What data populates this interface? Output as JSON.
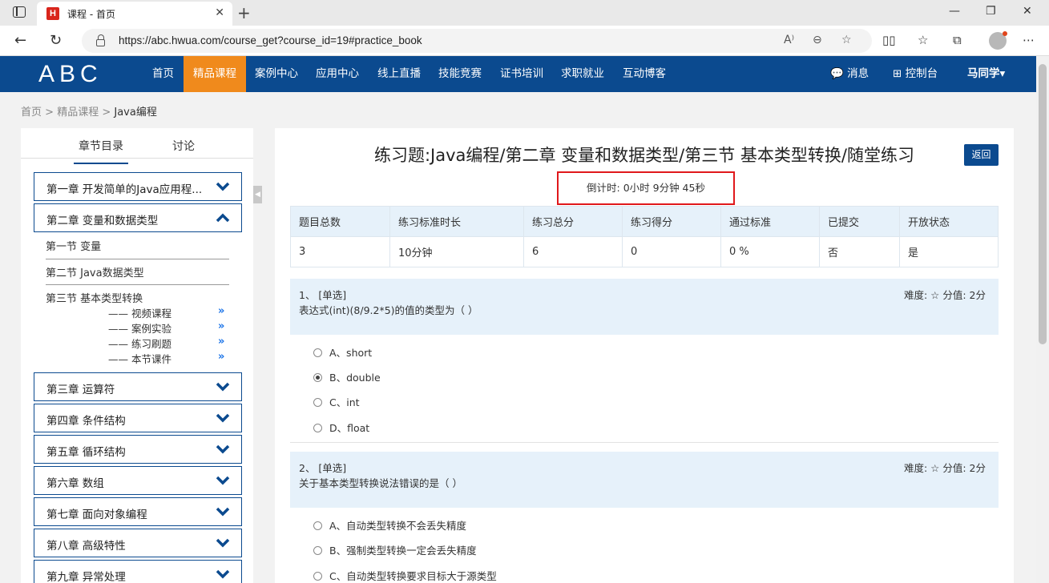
{
  "browser": {
    "tab_title": "课程 - 首页",
    "favicon_letter": "H",
    "url": "https://abc.hwua.com/course_get?course_id=19#practice_book"
  },
  "site": {
    "logo": "ABC",
    "nav": [
      "首页",
      "精品课程",
      "案例中心",
      "应用中心",
      "线上直播",
      "技能竞赛",
      "证书培训",
      "求职就业",
      "互动博客"
    ],
    "active_nav": "精品课程",
    "messages": "消息",
    "dashboard": "控制台",
    "user": "马同学",
    "accent_color": "#0b4a8f",
    "active_color": "#f08a1c"
  },
  "breadcrumb": [
    "首页",
    "精品课程",
    "Java编程"
  ],
  "sidebar": {
    "tabs": [
      "章节目录",
      "讨论"
    ],
    "chapters": [
      "第一章 开发简单的Java应用程...",
      "第二章 变量和数据类型",
      "第三章 运算符",
      "第四章 条件结构",
      "第五章 循环结构",
      "第六章 数组",
      "第七章 面向对象编程",
      "第八章 高级特性",
      "第九章 异常处理"
    ],
    "sections": [
      "第一节 变量",
      "第二节 Java数据类型",
      "第三节 基本类型转换"
    ],
    "subitems": [
      "—— 视频课程",
      "—— 案例实验",
      "—— 练习刷题",
      "—— 本节课件"
    ]
  },
  "main": {
    "title": "练习题:Java编程/第二章 变量和数据类型/第三节 基本类型转换/随堂练习",
    "back": "返回",
    "countdown": "倒计时:  0小时 9分钟 45秒",
    "stats_headers": [
      "题目总数",
      "练习标准时长",
      "练习总分",
      "练习得分",
      "通过标准",
      "已提交",
      "开放状态"
    ],
    "stats_values": [
      "3",
      "10分钟",
      "6",
      "0",
      "0 %",
      "否",
      "是"
    ],
    "questions": [
      {
        "num": "1、 [单选]",
        "text": "表达式(int)(8/9.2*5)的值的类型为（ ）",
        "meta": "难度: ☆  分值: 2分",
        "options": [
          "A、short",
          "B、double",
          "C、int",
          "D、float"
        ],
        "selected": 1
      },
      {
        "num": "2、 [单选]",
        "text": "关于基本类型转换说法错误的是（ ）",
        "meta": "难度: ☆  分值: 2分",
        "options": [
          "A、自动类型转换不会丢失精度",
          "B、强制类型转换一定会丢失精度",
          "C、自动类型转换要求目标大于源类型"
        ],
        "selected": -1
      }
    ]
  }
}
